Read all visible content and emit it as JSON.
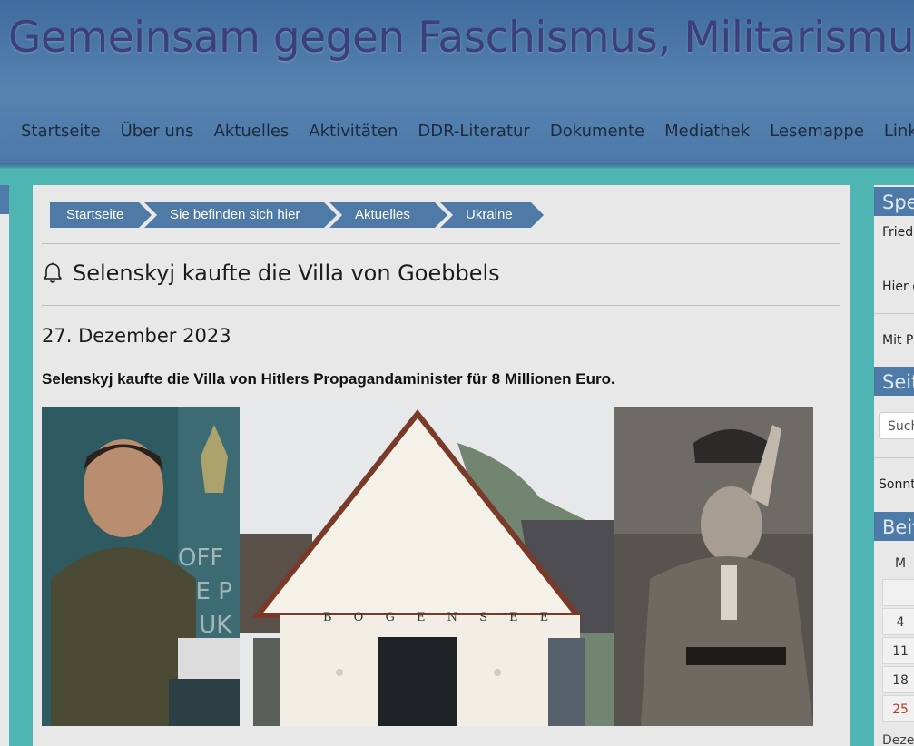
{
  "site": {
    "title": "Gemeinsam gegen Faschismus, Militarismus"
  },
  "nav": {
    "items": [
      "Startseite",
      "Über uns",
      "Aktuelles",
      "Aktivitäten",
      "DDR-Literatur",
      "Dokumente",
      "Mediathek",
      "Lesemappe",
      "Links"
    ]
  },
  "breadcrumb": {
    "items": [
      "Startseite",
      "Sie befinden sich hier",
      "Aktuelles",
      "Ukraine"
    ]
  },
  "article": {
    "title": "Selenskyj kaufte die Villa von Goebbels",
    "date": "27. Dezember 2023",
    "lead": "Selenskyj kaufte die Villa von Hitlers Propagandaminister für 8 Millionen Euro.",
    "building_sign": "B O G E N S E E"
  },
  "sidebar": {
    "headers": [
      "Spe",
      "Seit",
      "Beit"
    ],
    "texts": [
      "Fried",
      "Hier g",
      "Mit P",
      "Sonnt",
      "Deze"
    ],
    "search_placeholder": "Such",
    "calendar": {
      "weekday": "M",
      "days": [
        "",
        "4",
        "11",
        "18",
        "25"
      ],
      "highlight_day_color": "#c0392b"
    }
  },
  "colors": {
    "header_blue": "#4a77a6",
    "teal_background": "#4fb5b3",
    "breadcrumb_blue": "#4f7aa6",
    "title_text": "#3b3f7c"
  }
}
